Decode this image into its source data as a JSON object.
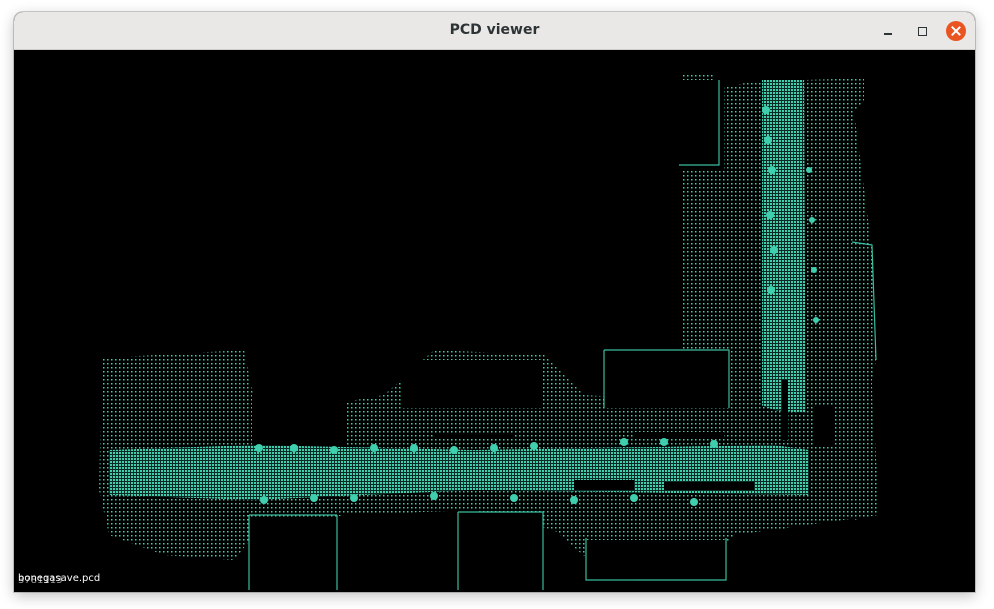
{
  "window": {
    "title": "PCD viewer",
    "buttons": {
      "minimize": "minimize-icon",
      "maximize": "maximize-icon",
      "close": "close-icon"
    }
  },
  "viewer": {
    "background": "#000000",
    "point_color": "#3fcfae",
    "overlay": {
      "filename": "bonegasave.pcd",
      "point_count": "3781113"
    }
  }
}
